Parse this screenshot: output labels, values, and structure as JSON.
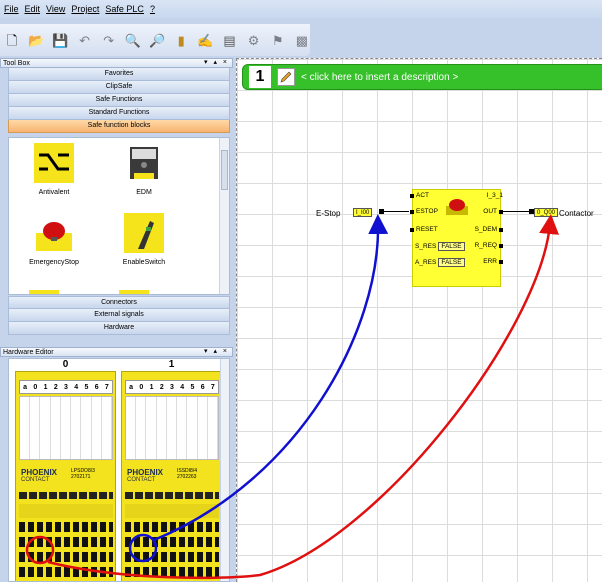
{
  "menu": [
    "File",
    "Edit",
    "View",
    "Project",
    "Safe PLC",
    "?"
  ],
  "toolbar_icons": [
    "new-icon",
    "open-icon",
    "save-icon",
    "undo-icon",
    "redo-icon",
    "zoom-in-icon",
    "zoom-out-icon",
    "library-icon",
    "compile-icon",
    "download-icon",
    "connect-icon",
    "debug-icon",
    "monitor-icon"
  ],
  "toolbox": {
    "title": "Tool Box",
    "controls": "▾ ▴ ×",
    "categories_top": [
      "Favorites",
      "ClipSafe",
      "Safe Functions",
      "Standard Functions",
      "Safe function blocks"
    ],
    "active_category": "Safe function blocks",
    "blocks": [
      "Antivalent",
      "EDM",
      "EmergencyStop",
      "EnableSwitch"
    ],
    "categories_bottom": [
      "Connectors",
      "External signals",
      "Hardware"
    ]
  },
  "hardware_editor": {
    "title": "Hardware Editor",
    "controls": "▾ ▴ ×",
    "slots": [
      "0",
      "1"
    ],
    "channels": [
      "a",
      "0",
      "1",
      "2",
      "3",
      "4",
      "5",
      "6",
      "7"
    ],
    "brand": "PHOENIX",
    "brand2": "CONTACT",
    "module_names": [
      "LPSDO8/3",
      "ISSDI8/4"
    ],
    "module_ids": [
      "2702171",
      "2702263"
    ]
  },
  "network": {
    "number": "1",
    "description_placeholder": "< click here to insert a description >"
  },
  "function_block": {
    "inputs": [
      "ACT",
      "ESTOP",
      "RESET",
      "S_RES",
      "A_RES"
    ],
    "outputs": [
      "I_3_1",
      "OUT",
      "S_DEM",
      "R_REQ",
      "ERR"
    ],
    "false_value": "FALSE",
    "input_tag": "I_I00",
    "output_tag": "0_Q00",
    "input_label": "E-Stop",
    "output_label": "Contactor"
  },
  "colors": {
    "network_header": "#36c12a",
    "function_block": "#ffff33",
    "arrow_blue": "#1010d0",
    "arrow_red": "#e01010",
    "active_category": "#f7b470"
  }
}
